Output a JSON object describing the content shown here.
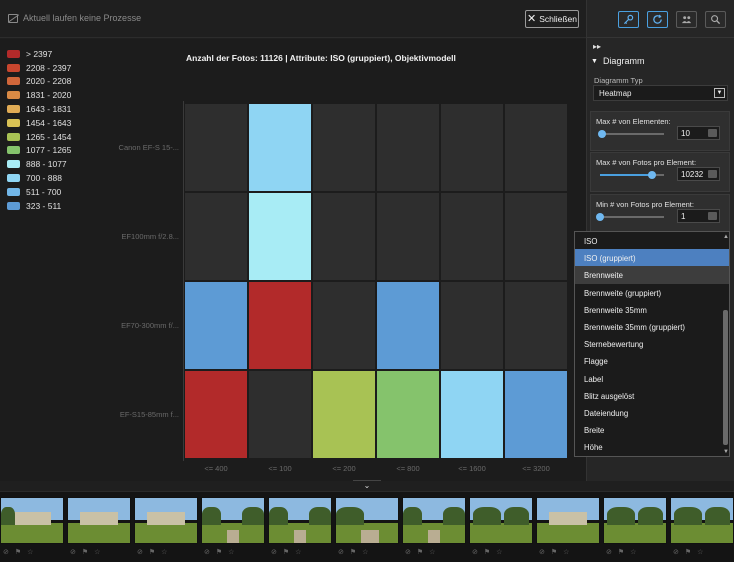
{
  "topbar": {
    "status_text": "Aktuell laufen keine Prozesse",
    "close_label": "Schließen"
  },
  "legend": [
    {
      "label": "> 2397",
      "color": "#b22a2a"
    },
    {
      "label": "2208 - 2397",
      "color": "#c8462e"
    },
    {
      "label": "2020 - 2208",
      "color": "#d0663a"
    },
    {
      "label": "1831 - 2020",
      "color": "#d98a45"
    },
    {
      "label": "1643 - 1831",
      "color": "#e0ab55"
    },
    {
      "label": "1454 - 1643",
      "color": "#d9c255"
    },
    {
      "label": "1265 - 1454",
      "color": "#a8c254"
    },
    {
      "label": "1077 - 1265",
      "color": "#85c36c"
    },
    {
      "label": "888 - 1077",
      "color": "#a8ecf5"
    },
    {
      "label": "700 - 888",
      "color": "#8fd5f3"
    },
    {
      "label": "511 - 700",
      "color": "#72b7e8"
    },
    {
      "label": "323 - 511",
      "color": "#5d9bd5"
    }
  ],
  "chart_data": {
    "type": "heatmap",
    "title": "Anzahl der Fotos: 11126 | Attribute: ISO (gruppiert), Objektivmodell",
    "x_categories": [
      "<= 400",
      "<= 100",
      "<= 200",
      "<= 800",
      "<= 1600",
      "<= 3200"
    ],
    "y_categories": [
      "Canon EF-S 15-...",
      "EF100mm f/2.8...",
      "EF70-300mm f/...",
      "EF-S15-85mm f..."
    ],
    "cells": [
      {
        "row": 0,
        "col": 0,
        "color": "#2e2e2e"
      },
      {
        "row": 0,
        "col": 1,
        "color": "#8fd5f3"
      },
      {
        "row": 0,
        "col": 2,
        "color": "#2e2e2e"
      },
      {
        "row": 0,
        "col": 3,
        "color": "#2e2e2e"
      },
      {
        "row": 0,
        "col": 4,
        "color": "#2e2e2e"
      },
      {
        "row": 0,
        "col": 5,
        "color": "#2e2e2e"
      },
      {
        "row": 1,
        "col": 0,
        "color": "#2e2e2e"
      },
      {
        "row": 1,
        "col": 1,
        "color": "#a8ecf5"
      },
      {
        "row": 1,
        "col": 2,
        "color": "#2e2e2e"
      },
      {
        "row": 1,
        "col": 3,
        "color": "#2e2e2e"
      },
      {
        "row": 1,
        "col": 4,
        "color": "#2e2e2e"
      },
      {
        "row": 1,
        "col": 5,
        "color": "#2e2e2e"
      },
      {
        "row": 2,
        "col": 0,
        "color": "#5d9bd5"
      },
      {
        "row": 2,
        "col": 1,
        "color": "#b22a2a"
      },
      {
        "row": 2,
        "col": 2,
        "color": "#2e2e2e"
      },
      {
        "row": 2,
        "col": 3,
        "color": "#5d9bd5"
      },
      {
        "row": 2,
        "col": 4,
        "color": "#2e2e2e"
      },
      {
        "row": 2,
        "col": 5,
        "color": "#2e2e2e"
      },
      {
        "row": 3,
        "col": 0,
        "color": "#b22a2a"
      },
      {
        "row": 3,
        "col": 1,
        "color": "#2e2e2e"
      },
      {
        "row": 3,
        "col": 2,
        "color": "#a8c254"
      },
      {
        "row": 3,
        "col": 3,
        "color": "#85c36c"
      },
      {
        "row": 3,
        "col": 4,
        "color": "#8fd5f3"
      },
      {
        "row": 3,
        "col": 5,
        "color": "#5d9bd5"
      }
    ]
  },
  "right_panel": {
    "toolbar": [
      {
        "icon": "key-icon",
        "active": true
      },
      {
        "icon": "refresh-icon",
        "active": true
      },
      {
        "icon": "users-icon",
        "active": false
      },
      {
        "icon": "zoom-icon",
        "active": false
      }
    ],
    "collapse_glyph": "▸▸",
    "section_title": "Diagramm",
    "chart_type_label": "Diagramm Typ",
    "chart_type_value": "Heatmap",
    "max_elements_label": "Max # von Elementen:",
    "max_elements_value": "10",
    "max_elements_fraction": 0.03,
    "max_photos_label": "Max # von Fotos pro Element:",
    "max_photos_value": "10232",
    "max_photos_fraction": 0.82,
    "min_photos_label": "Min # von Fotos pro Element:",
    "min_photos_value": "1",
    "min_photos_fraction": 0.0
  },
  "dropdown": {
    "items": [
      {
        "label": "ISO",
        "state": ""
      },
      {
        "label": "ISO (gruppiert)",
        "state": "selected"
      },
      {
        "label": "Brennweite",
        "state": "hover"
      },
      {
        "label": "Brennweite (gruppiert)",
        "state": ""
      },
      {
        "label": "Brennweite 35mm",
        "state": ""
      },
      {
        "label": "Brennweite 35mm (gruppiert)",
        "state": ""
      },
      {
        "label": "Sternebewertung",
        "state": ""
      },
      {
        "label": "Flagge",
        "state": ""
      },
      {
        "label": "Label",
        "state": ""
      },
      {
        "label": "Blitz ausgelöst",
        "state": ""
      },
      {
        "label": "Dateiendung",
        "state": ""
      },
      {
        "label": "Breite",
        "state": ""
      },
      {
        "label": "Höhe",
        "state": ""
      }
    ]
  },
  "filmstrip": {
    "toggle_glyph": "⌄",
    "thumbnails": [
      {
        "scene": "building-tree"
      },
      {
        "scene": "building"
      },
      {
        "scene": "building"
      },
      {
        "scene": "garden"
      },
      {
        "scene": "garden"
      },
      {
        "scene": "path"
      },
      {
        "scene": "garden"
      },
      {
        "scene": "trees"
      },
      {
        "scene": "building"
      },
      {
        "scene": "trees"
      },
      {
        "scene": "trees"
      }
    ]
  }
}
